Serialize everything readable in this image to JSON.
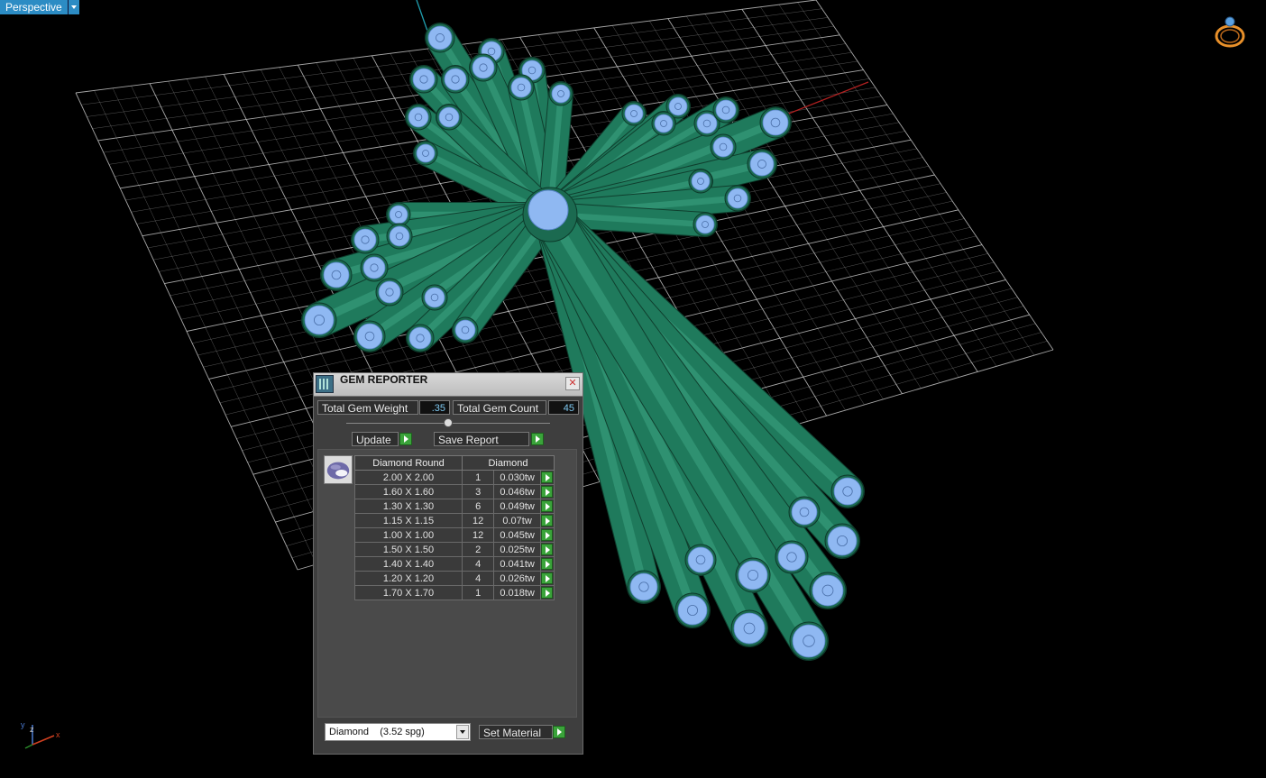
{
  "viewport": {
    "name": "Perspective"
  },
  "gem_reporter": {
    "title": "GEM REPORTER",
    "close_label": "✕",
    "total_weight_label": "Total Gem Weight",
    "total_weight_value": ".35",
    "total_count_label": "Total Gem Count",
    "total_count_value": "45",
    "update_label": "Update",
    "save_report_label": "Save Report",
    "table": {
      "col_size": "Diamond Round",
      "col_material": "Diamond",
      "rows": [
        {
          "size": "2.00 X 2.00",
          "count": "1",
          "weight": "0.030tw"
        },
        {
          "size": "1.60 X 1.60",
          "count": "3",
          "weight": "0.046tw"
        },
        {
          "size": "1.30 X 1.30",
          "count": "6",
          "weight": "0.049tw"
        },
        {
          "size": "1.15 X 1.15",
          "count": "12",
          "weight": "0.07tw"
        },
        {
          "size": "1.00 X 1.00",
          "count": "12",
          "weight": "0.045tw"
        },
        {
          "size": "1.50 X 1.50",
          "count": "2",
          "weight": "0.025tw"
        },
        {
          "size": "1.40 X 1.40",
          "count": "4",
          "weight": "0.041tw"
        },
        {
          "size": "1.20 X 1.20",
          "count": "4",
          "weight": "0.026tw"
        },
        {
          "size": "1.70 X 1.70",
          "count": "1",
          "weight": "0.018tw"
        }
      ]
    },
    "material_select": "Diamond    (3.52 spg)",
    "set_material_label": "Set Material"
  },
  "axis_labels": {
    "y": "y",
    "z": "z",
    "x": "x"
  },
  "colors": {
    "grid": "#cfcfcf",
    "tube": "#1f7a5c",
    "gem": "#8fb8f2",
    "accent": "#2c8cc4",
    "go_button": "#3aa33a"
  }
}
